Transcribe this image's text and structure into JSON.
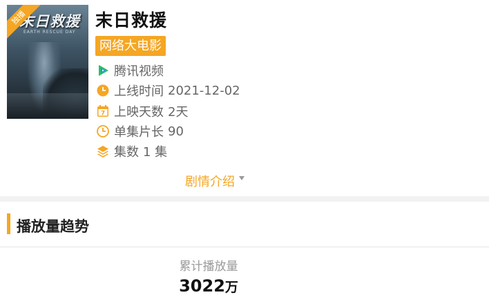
{
  "movie": {
    "poster": {
      "ribbon": "独播",
      "title": "末日救援",
      "subtitle": "EARTH RESCUE DAY"
    },
    "title": "末日救援",
    "category": "网络大电影",
    "platform": "腾讯视频",
    "info": [
      {
        "icon": "clock-icon",
        "label": "上线时间",
        "value": "2021-12-02"
      },
      {
        "icon": "calendar-icon",
        "label": "上映天数",
        "value": "2天"
      },
      {
        "icon": "timer-icon",
        "label": "单集片长",
        "value": "90"
      },
      {
        "icon": "layers-icon",
        "label": "集数",
        "value": "1 集"
      }
    ],
    "synopsis_link": "剧情介绍"
  },
  "trend": {
    "heading": "播放量趋势",
    "total_label": "累计播放量",
    "total_number": "3022",
    "total_unit": "万"
  },
  "colors": {
    "accent": "#f5a623",
    "tencent_green": "#27c262",
    "tencent_blue": "#2d8cf0"
  }
}
